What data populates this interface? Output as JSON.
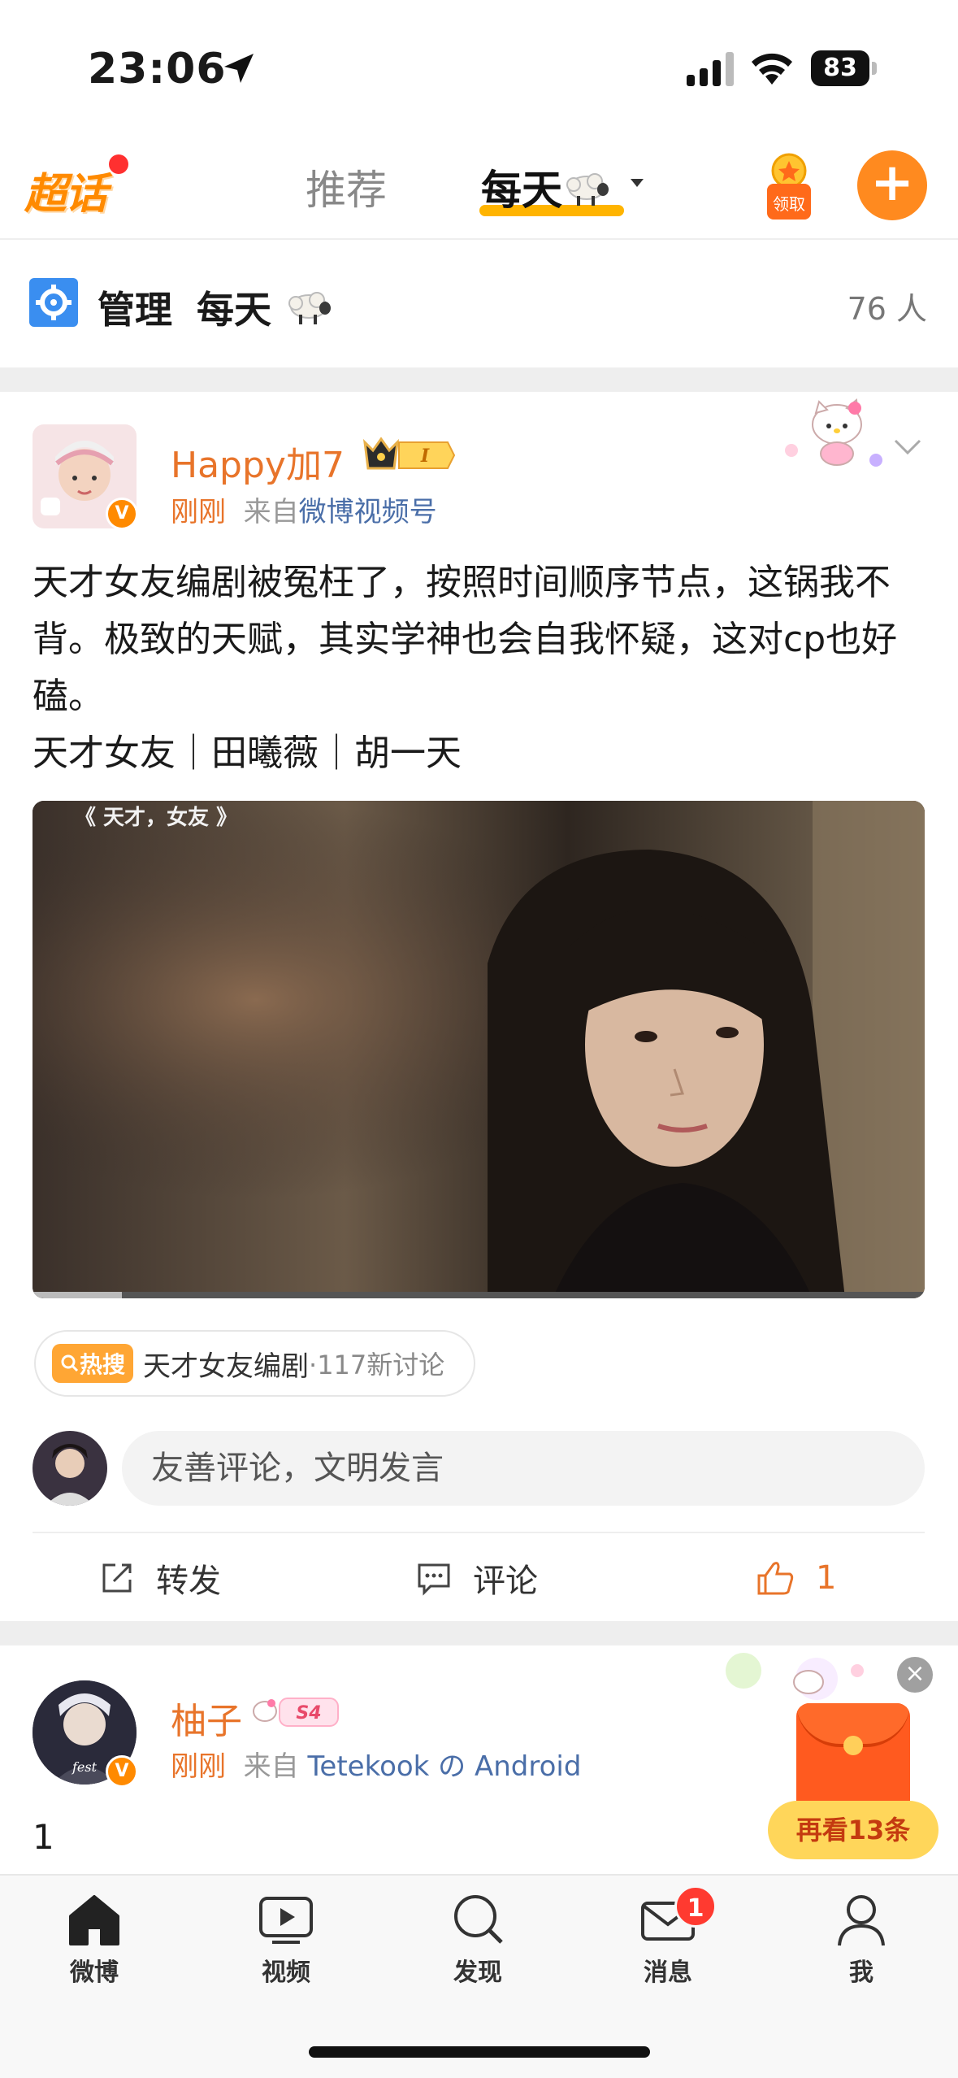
{
  "status_bar": {
    "time": "23:06",
    "battery": "83"
  },
  "top_nav": {
    "logo": "超话",
    "tabs": [
      {
        "label": "推荐"
      },
      {
        "label": "每天"
      }
    ],
    "reward_label": "领取",
    "plus_label": "+"
  },
  "manage_row": {
    "label": "管理",
    "name": "每天",
    "member_count": "76 人"
  },
  "post": {
    "username": "Happy加7",
    "level_badge": "I",
    "time": "刚刚",
    "from_prefix": "来自",
    "source": "微博视频号",
    "text": "天才女友编剧被冤枉了，按照时间顺序节点，这锅我不背。极致的天赋，其实学神也会自我怀疑，这对cp也好磕。\n天才女友｜田曦薇｜胡一天",
    "video_title": "《 天才，女友 》",
    "hot": {
      "tag": "热搜",
      "topic": "天才女友编剧",
      "discussion": "·117新讨论"
    },
    "comment_placeholder": "友善评论，文明发言",
    "actions": {
      "forward": "转发",
      "comment": "评论",
      "like_count": "1"
    }
  },
  "post2": {
    "username": "柚子",
    "badge": "S4",
    "time": "刚刚",
    "from_prefix": "来自",
    "source": "Tetekook の Android",
    "text": "1",
    "see_more": "再看13条",
    "close": "×"
  },
  "bottom_nav": {
    "items": [
      {
        "label": "微博",
        "icon": "home-icon"
      },
      {
        "label": "视频",
        "icon": "video-icon"
      },
      {
        "label": "发现",
        "icon": "search-icon"
      },
      {
        "label": "消息",
        "icon": "mail-icon",
        "badge": "1"
      },
      {
        "label": "我",
        "icon": "person-icon"
      }
    ]
  },
  "colors": {
    "accent_orange": "#ff8a1f",
    "username_orange": "#e8742a",
    "link_blue": "#4a6ea8",
    "tab_underline": "#ffb400",
    "badge_red": "#ff3a30"
  }
}
